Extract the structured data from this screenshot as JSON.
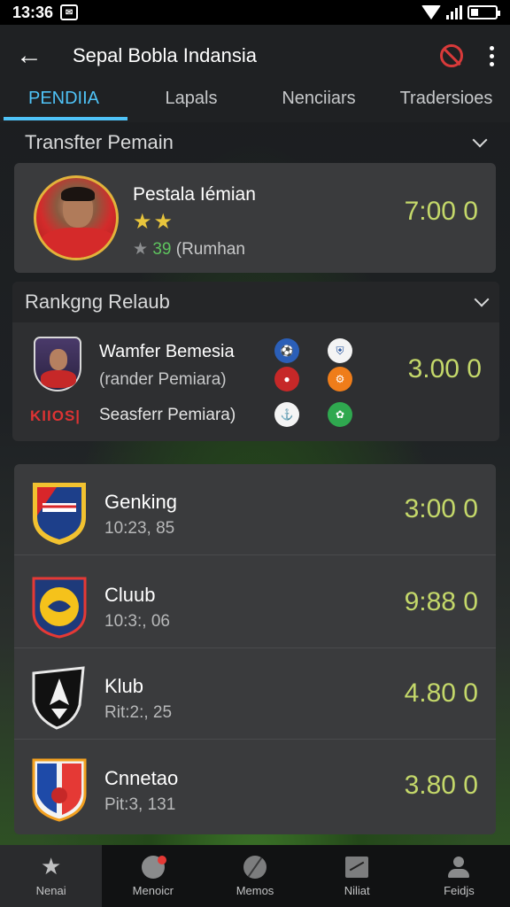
{
  "status": {
    "time": "13:36",
    "msg_icon": "message-icon"
  },
  "appbar": {
    "title": "Sepal Bobla Indansia"
  },
  "tabs": [
    {
      "label": "PENDIIA",
      "active": true
    },
    {
      "label": "Lapals"
    },
    {
      "label": "Nenciiars"
    },
    {
      "label": "Tradersioes"
    }
  ],
  "transfer": {
    "header": "Transfter Pemain",
    "player": {
      "name": "Pestala Iémian",
      "stars": "★★",
      "meta_star": "★",
      "meta_num": "39",
      "meta_text": "(Rumhan",
      "score": "7:00 0"
    }
  },
  "ranking": {
    "header": "Rankgng Relaub",
    "top": {
      "line1": "Wamfer Bemesia",
      "line2": "(rander Pemiara)",
      "line3": "Seasferr Pemiara)",
      "logo_text": "KIIOS|",
      "score": "3.00 0"
    },
    "list": [
      {
        "title": "Genking",
        "sub": "10:23, 85",
        "score": "3:00 0"
      },
      {
        "title": "Cluub",
        "sub": "10:3:, 06",
        "score": "9:88 0"
      },
      {
        "title": "Klub",
        "sub": "Rit:2:, 25",
        "score": "4.80 0"
      },
      {
        "title": "Cnnetao",
        "sub": "Pit:3, 131",
        "score": "3.80 0"
      }
    ]
  },
  "bottom_nav": [
    {
      "label": "Nenai",
      "icon": "star-icon",
      "active": true
    },
    {
      "label": "Menoicr",
      "icon": "ball-icon"
    },
    {
      "label": "Memos",
      "icon": "globe-icon"
    },
    {
      "label": "Niliat",
      "icon": "chart-icon"
    },
    {
      "label": "Feidjs",
      "icon": "person-icon"
    }
  ],
  "colors": {
    "accent": "#4fc3f7",
    "score": "#c4d86a",
    "alert": "#d83a3a"
  }
}
